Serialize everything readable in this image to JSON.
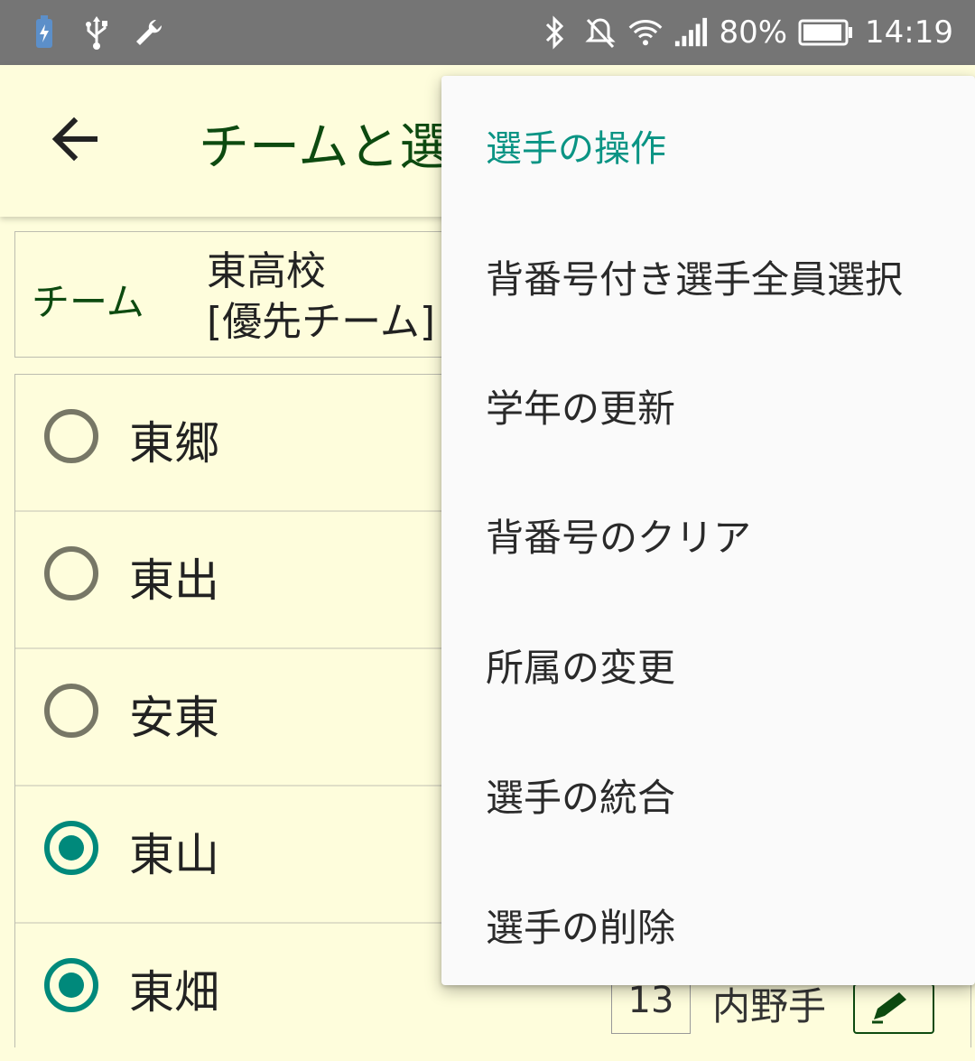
{
  "status_bar": {
    "battery_percent": "80%",
    "time": "14:19",
    "icons_left": [
      "battery-charging-icon",
      "usb-icon",
      "wrench-icon"
    ],
    "icons_right": [
      "bluetooth-icon",
      "mute-icon",
      "wifi-icon",
      "signal-icon",
      "battery-icon"
    ]
  },
  "app_bar": {
    "title": "チームと選"
  },
  "team": {
    "label": "チーム",
    "name_line1": "東高校",
    "name_line2": "[優先チーム]"
  },
  "players": [
    {
      "name": "東郷",
      "selected": false
    },
    {
      "name": "東出",
      "selected": false
    },
    {
      "name": "安東",
      "selected": false
    },
    {
      "name": "東山",
      "selected": true
    },
    {
      "name": "東畑",
      "selected": true,
      "number": "13",
      "position": "内野手"
    }
  ],
  "menu": {
    "header": "選手の操作",
    "items": [
      "背番号付き選手全員選択",
      "学年の更新",
      "背番号のクリア",
      "所属の変更",
      "選手の統合",
      "選手の削除"
    ]
  },
  "colors": {
    "background": "#fefddc",
    "accent": "#00897b",
    "title_green": "#0d4a10",
    "menu_header": "#0a9484"
  }
}
